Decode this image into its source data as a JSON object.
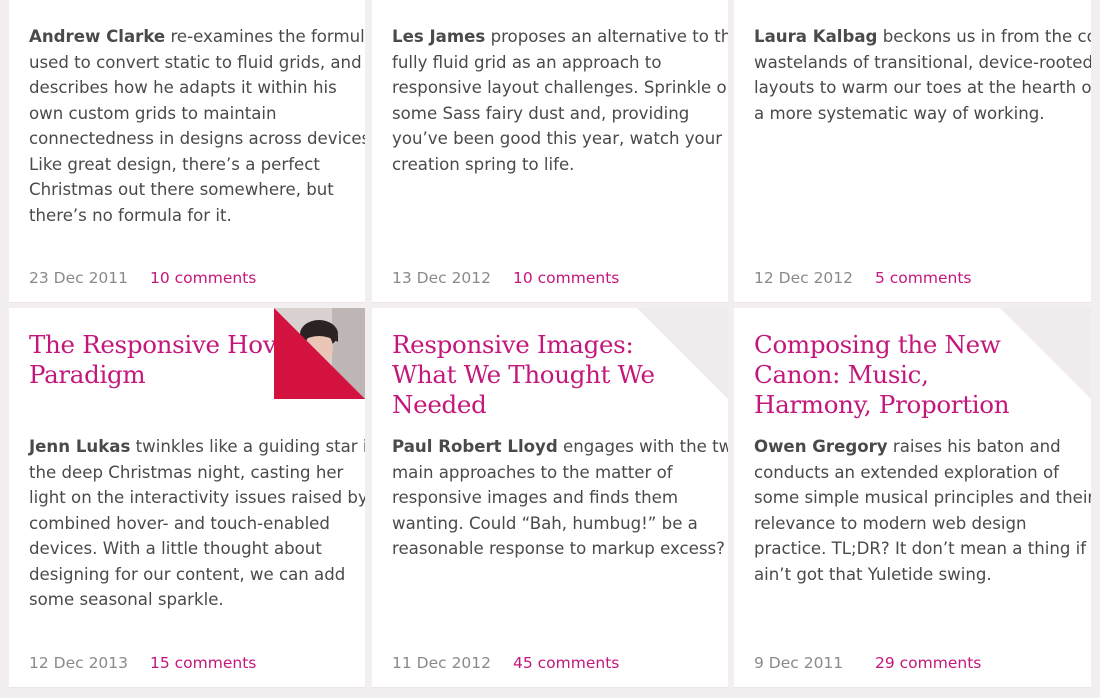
{
  "row1": [
    {
      "author": "Andrew Clarke",
      "desc_lines": [
        "re-examines the formula",
        "used to convert static to fluid grids, and",
        "describes how he adapts it within his",
        "own custom grids to maintain",
        "connectedness in designs across devices.",
        "Like great design, there’s a perfect",
        "Christmas out there somewhere, but",
        "there’s no formula for it."
      ],
      "date": "23 Dec 2011",
      "comments": "10 comments"
    },
    {
      "author": "Les James",
      "desc_lines": [
        "proposes an alternative to the",
        "fully fluid grid as an approach to",
        "responsive layout challenges. Sprinkle on",
        "some Sass fairy dust and, providing",
        "you’ve been good this year, watch your",
        "creation spring to life."
      ],
      "date": "13 Dec 2012",
      "comments": "10 comments"
    },
    {
      "author": "Laura Kalbag",
      "desc_lines": [
        "beckons us in from the cold",
        "wastelands of transitional, device-rooted",
        "layouts to warm our toes at the hearth of",
        "a more systematic way of working."
      ],
      "date": "12 Dec 2012",
      "comments": "5 comments"
    }
  ],
  "row2": [
    {
      "title_lines": [
        "The Responsive Hover",
        "Paradigm"
      ],
      "author": "Jenn Lukas",
      "desc_lines": [
        "twinkles like a guiding star in",
        "the deep Christmas night, casting her",
        "light on the interactivity issues raised by",
        "combined hover- and touch-enabled",
        "devices. With a little thought about",
        "designing for our content, we can add",
        "some seasonal sparkle."
      ],
      "date": "12 Dec 2013",
      "comments": "15 comments"
    },
    {
      "title_lines": [
        "Responsive Images:",
        "What We Thought We",
        "Needed"
      ],
      "author": "Paul Robert Lloyd",
      "desc_lines": [
        "engages with the two",
        "main approaches to the matter of",
        "responsive images and finds them",
        "wanting. Could “Bah, humbug!” be a",
        "reasonable response to markup excess?"
      ],
      "date": "11 Dec 2012",
      "comments": "45 comments"
    },
    {
      "title_lines": [
        "Composing the New",
        "Canon: Music,",
        "Harmony, Proportion"
      ],
      "author": "Owen Gregory",
      "desc_lines": [
        "raises his baton and",
        "conducts an extended exploration of",
        "some simple musical principles and their",
        "relevance to modern web design",
        "practice. TL;DR? It don’t mean a thing if it",
        "ain’t got that Yuletide swing."
      ],
      "date": "9 Dec 2011",
      "comments": "29 comments"
    }
  ],
  "colors": {
    "accent": "#c4177c",
    "corner_red": "#d3123f",
    "corner_grey": "#f0ecee",
    "text": "#4a4a4a",
    "muted": "#8a8a8a"
  }
}
